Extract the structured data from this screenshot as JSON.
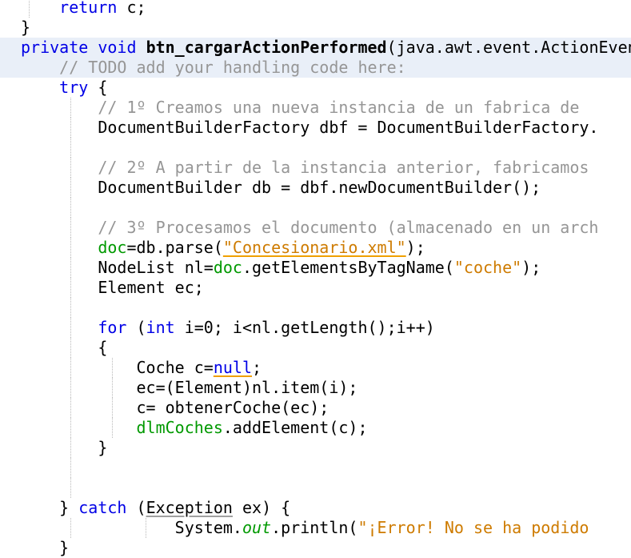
{
  "code": {
    "l0_kw": "return",
    "l0_rest": " c;",
    "l1": "}",
    "l2_kw1": "private",
    "l2_kw2": "void",
    "l2_method": "btn_cargarActionPerformed",
    "l2_rest": "(java.awt.event.ActionEvent",
    "l3": "// TODO add your handling code here:",
    "l4_kw": "try",
    "l4_rest": " {",
    "l5": "// 1º Creamos una nueva instancia de un fabrica de",
    "l6": "DocumentBuilderFactory dbf = DocumentBuilderFactory.",
    "l8": "// 2º A partir de la instancia anterior, fabricamos",
    "l9": "DocumentBuilder db = dbf.newDocumentBuilder();",
    "l11": "// 3º Procesamos el documento (almacenado en un arch",
    "l12_a": "doc",
    "l12_b": "=db.parse(",
    "l12_str": "\"Concesionario.xml\"",
    "l12_c": ");",
    "l13_a": "NodeList nl=",
    "l13_b": "doc",
    "l13_c": ".getElementsByTagName(",
    "l13_str": "\"coche\"",
    "l13_d": ");",
    "l14": "Element ec;",
    "l16_kw1": "for",
    "l16_a": " (",
    "l16_kw2": "int",
    "l16_b": " i=0; i<nl.getLength();i++)",
    "l17": "{",
    "l18_a": "Coche c=",
    "l18_kw": "null",
    "l18_b": ";",
    "l19": "ec=(Element)nl.item(i);",
    "l20": "c= obtenerCoche(ec);",
    "l21_a": "dlmCoches",
    "l21_b": ".addElement(c);",
    "l22": "}",
    "l25_a": "} ",
    "l25_kw": "catch",
    "l25_b": " (",
    "l25_exc": "Exception",
    "l25_c": " ex) {",
    "l26_a": "System.",
    "l26_out": "out",
    "l26_b": ".println(",
    "l26_str": "\"¡Error! No se ha podido",
    "l27": "}"
  },
  "colors": {
    "keyword": "#0000e6",
    "comment": "#969696",
    "string": "#ce7b00",
    "field": "#009900",
    "current_line": "#e9eff8"
  }
}
